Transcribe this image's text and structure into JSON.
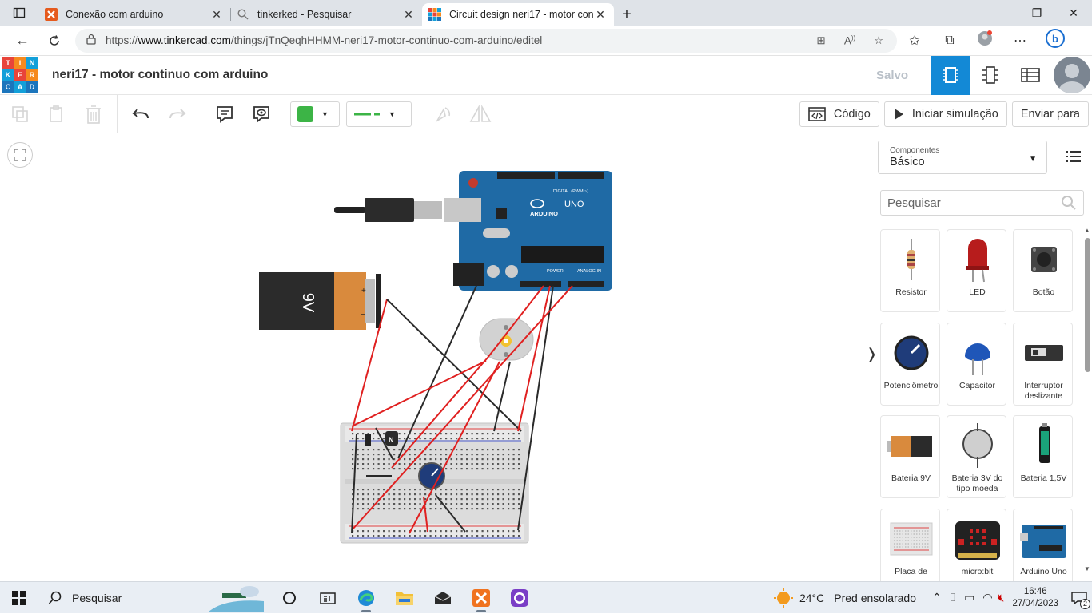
{
  "browser": {
    "tabs": [
      {
        "title": "Conexão com arduino",
        "favicon": "tinkercad-x-icon",
        "active": false
      },
      {
        "title": "tinkerked - Pesquisar",
        "favicon": "search-icon",
        "active": false
      },
      {
        "title": "Circuit design neri17 - motor con",
        "favicon": "tinkercad-logo-icon",
        "active": true
      }
    ],
    "url_prefix": "https://",
    "url_host": "www.tinkercad.com",
    "url_path": "/things/jTnQeqhHHMM-neri17-motor-continuo-com-arduino/editel"
  },
  "app": {
    "logo_letters": [
      "TIN",
      "KER",
      "CAD"
    ],
    "logo_colors": [
      "#e8443a",
      "#f68a1e",
      "#14a0d9",
      "#1c75bc"
    ],
    "project_title": "neri17 - motor continuo com arduino",
    "save_status": "Salvo",
    "accent": "#1389d6"
  },
  "toolbar": {
    "fill_color": "#3cb446",
    "wire_color": "#3cb446",
    "code_label": "Código",
    "simulate_label": "Iniciar simulação",
    "send_label": "Enviar para"
  },
  "canvas": {
    "battery_label": "9V",
    "battery_plus": "+",
    "battery_minus": "−",
    "arduino_brand": "ARDUINO",
    "arduino_model": "UNO",
    "arduino_header_digital": "DIGITAL (PWM ~)",
    "arduino_header_power": "POWER",
    "arduino_header_analog": "ANALOG IN",
    "transistor_label": "N",
    "wire_red": "#e02020",
    "wire_black": "#2a2a2a"
  },
  "panel": {
    "components_label": "Componentes",
    "components_value": "Básico",
    "search_placeholder": "Pesquisar",
    "items": [
      {
        "name": "Resistor",
        "icon": "resistor-icon"
      },
      {
        "name": "LED",
        "icon": "led-icon"
      },
      {
        "name": "Botão",
        "icon": "pushbutton-icon"
      },
      {
        "name": "Potenciômetro",
        "icon": "potentiometer-icon"
      },
      {
        "name": "Capacitor",
        "icon": "capacitor-icon"
      },
      {
        "name": "Interruptor deslizante",
        "icon": "slide-switch-icon"
      },
      {
        "name": "Bateria 9V",
        "icon": "battery-9v-icon"
      },
      {
        "name": "Bateria 3V do tipo moeda",
        "icon": "coin-battery-icon"
      },
      {
        "name": "Bateria 1,5V",
        "icon": "battery-aa-icon"
      },
      {
        "name": "Placa de",
        "icon": "breadboard-icon"
      },
      {
        "name": "micro:bit",
        "icon": "microbit-icon"
      },
      {
        "name": "Arduino Uno",
        "icon": "arduino-uno-icon"
      }
    ]
  },
  "taskbar": {
    "search_label": "Pesquisar",
    "weather_temp": "24°C",
    "weather_desc": "Pred ensolarado",
    "time": "16:46",
    "date": "27/04/2023",
    "notifications": "2"
  }
}
